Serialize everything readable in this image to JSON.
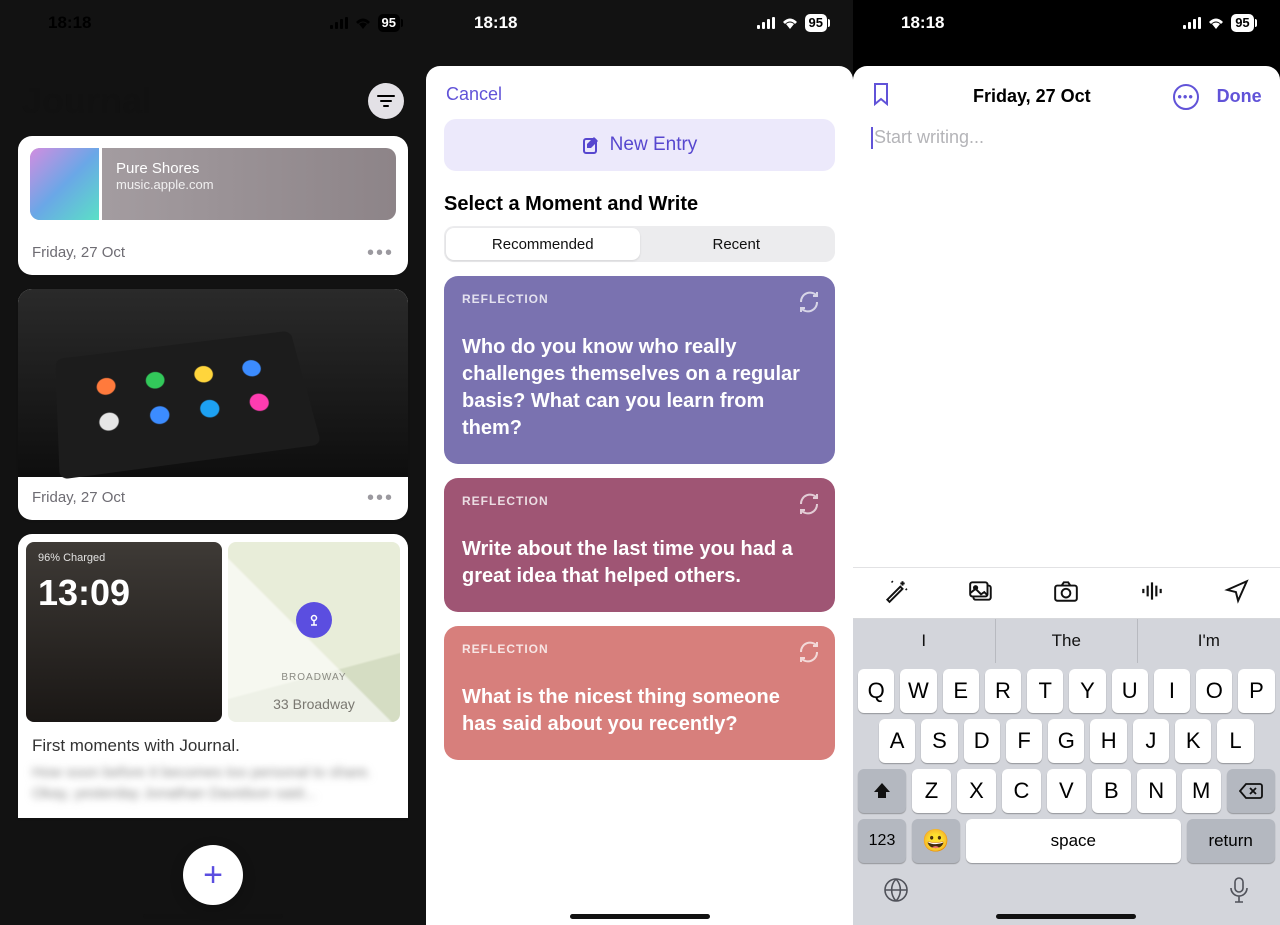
{
  "status": {
    "time": "18:18",
    "battery": "95"
  },
  "p1": {
    "title": "Journal",
    "card1": {
      "music_title": "Pure Shores",
      "music_sub": "music.apple.com",
      "date": "Friday, 27 Oct"
    },
    "card2": {
      "date": "Friday, 27 Oct"
    },
    "card3": {
      "charge": "96% Charged",
      "clock": "13:09",
      "broadway_label": "BROADWAY",
      "address": "33 Broadway",
      "caption": "First moments with Journal.",
      "blurred": "How soon before it becomes too personal to share. Okay, yesterday Jonathan Davidson said..."
    }
  },
  "p2": {
    "cancel": "Cancel",
    "new_entry": "New Entry",
    "section": "Select a Moment and Write",
    "seg_recommended": "Recommended",
    "seg_recent": "Recent",
    "reflection_tag": "REFLECTION",
    "prompt1": "Who do you know who really challenges themselves on a regular basis? What can you learn from them?",
    "prompt2": "Write about the last time you had a great idea that helped others.",
    "prompt3": "What is the nicest thing someone has said about you recently?"
  },
  "p3": {
    "date": "Friday, 27 Oct",
    "done": "Done",
    "placeholder": "Start writing...",
    "suggest": [
      "I",
      "The",
      "I'm"
    ],
    "rows": {
      "r1": [
        "Q",
        "W",
        "E",
        "R",
        "T",
        "Y",
        "U",
        "I",
        "O",
        "P"
      ],
      "r2": [
        "A",
        "S",
        "D",
        "F",
        "G",
        "H",
        "J",
        "K",
        "L"
      ],
      "r3": [
        "Z",
        "X",
        "C",
        "V",
        "B",
        "N",
        "M"
      ]
    },
    "k123": "123",
    "space": "space",
    "return": "return"
  }
}
